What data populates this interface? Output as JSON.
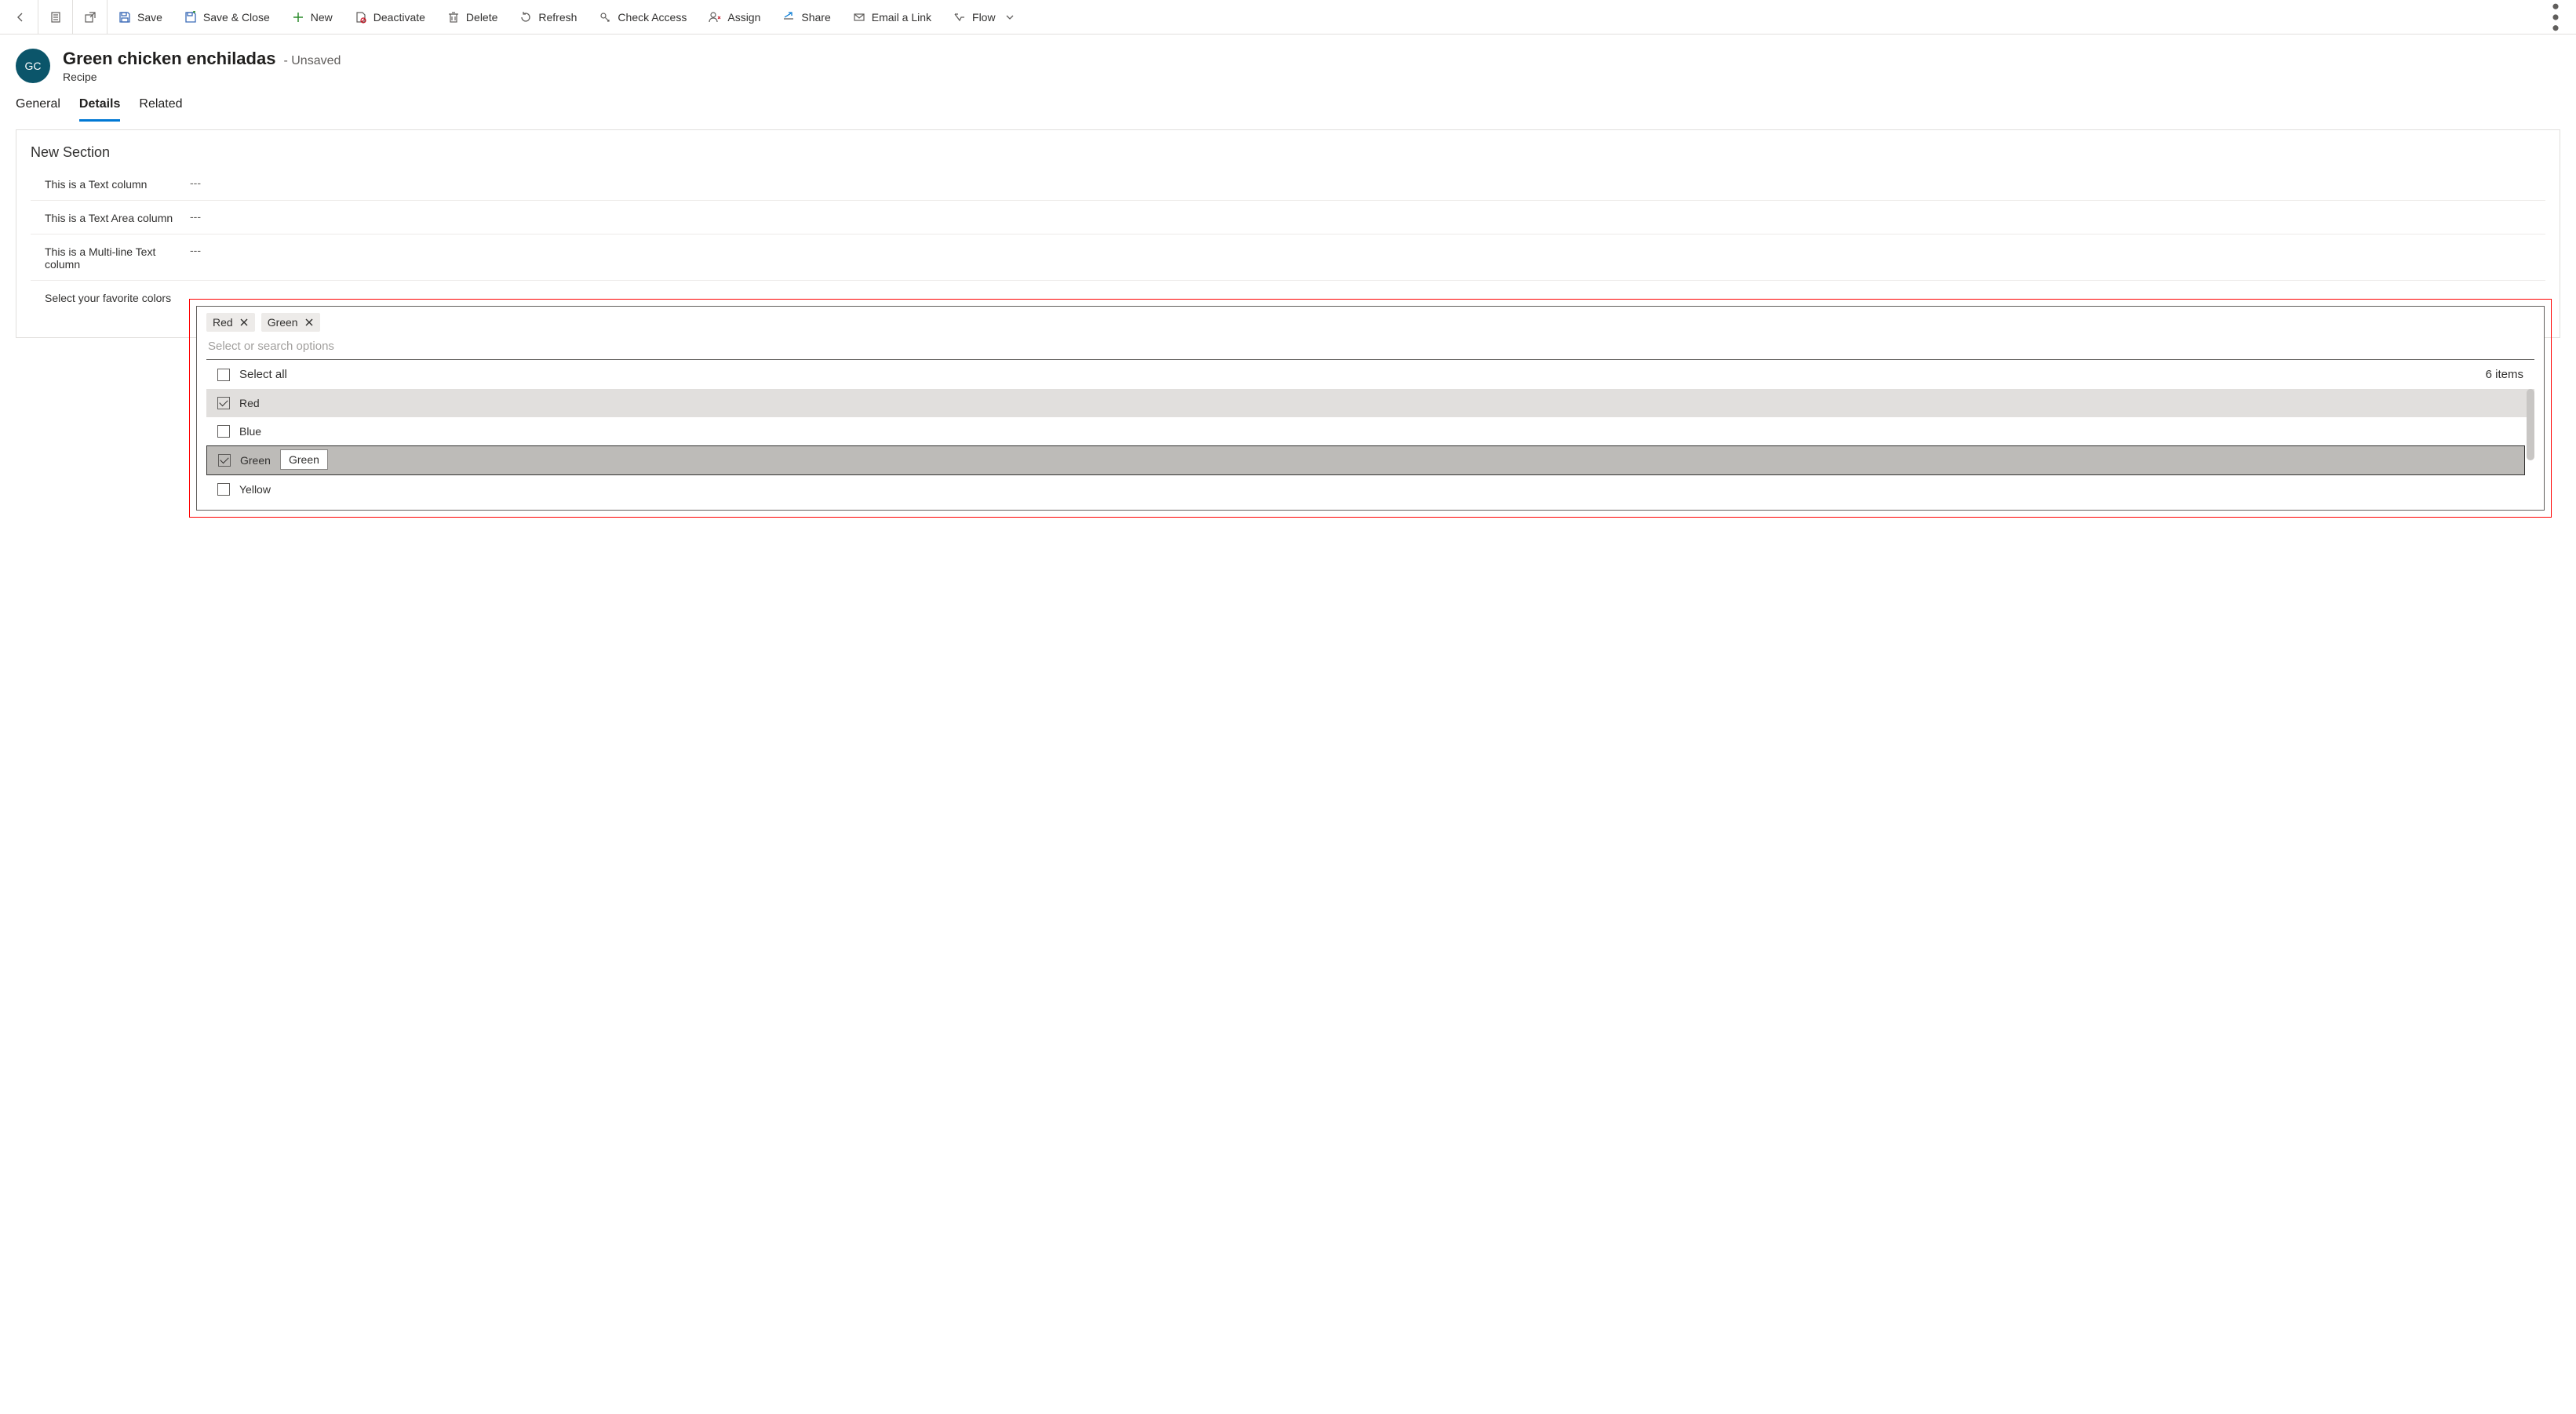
{
  "commandBar": {
    "save": "Save",
    "saveClose": "Save & Close",
    "new": "New",
    "deactivate": "Deactivate",
    "delete": "Delete",
    "refresh": "Refresh",
    "checkAccess": "Check Access",
    "assign": "Assign",
    "share": "Share",
    "emailLink": "Email a Link",
    "flow": "Flow"
  },
  "header": {
    "avatarInitials": "GC",
    "title": "Green chicken enchiladas",
    "status": "- Unsaved",
    "subtitle": "Recipe"
  },
  "tabs": {
    "general": "General",
    "details": "Details",
    "related": "Related"
  },
  "section": {
    "title": "New Section",
    "fields": [
      {
        "label": "This is a Text column",
        "value": "---"
      },
      {
        "label": "This is a Text Area column",
        "value": "---"
      },
      {
        "label": "This is a Multi-line Text column",
        "value": "---"
      },
      {
        "label": "Select your favorite colors",
        "value": ""
      }
    ]
  },
  "multiselect": {
    "placeholder": "Select or search options",
    "chips": [
      "Red",
      "Green"
    ],
    "selectAllLabel": "Select all",
    "countLabel": "6 items",
    "options": [
      {
        "label": "Red",
        "checked": true,
        "state": "selected"
      },
      {
        "label": "Blue",
        "checked": false,
        "state": ""
      },
      {
        "label": "Green",
        "checked": true,
        "state": "highlighted"
      },
      {
        "label": "Yellow",
        "checked": false,
        "state": ""
      }
    ],
    "tooltip": "Green"
  }
}
